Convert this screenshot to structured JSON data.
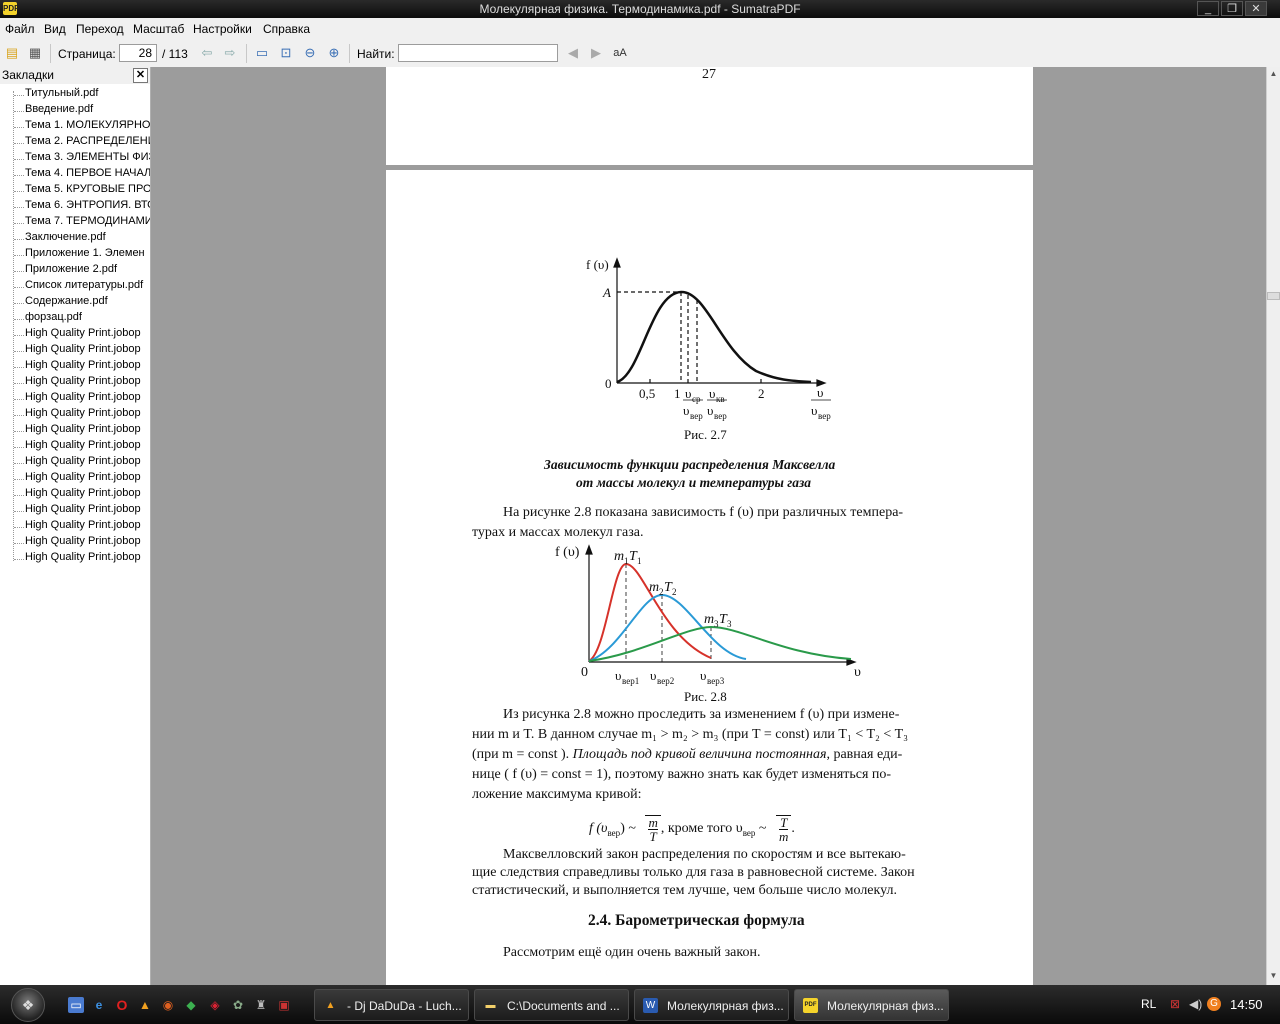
{
  "window": {
    "title": "Молекулярная физика. Термодинамика.pdf - SumatraPDF",
    "app_icon": "sumatra-icon"
  },
  "menu": [
    "Файл",
    "Вид",
    "Переход",
    "Масштаб",
    "Настройки",
    "Справка"
  ],
  "toolbar": {
    "page_label": "Страница:",
    "page_value": "28",
    "page_total": "/ 113",
    "find_label": "Найти:",
    "find_value": "",
    "font_icon_label": "aA"
  },
  "sidebar": {
    "title": "Закладки",
    "items": [
      "Титульный.pdf",
      "Введение.pdf",
      "Тема 1. МОЛЕКУЛЯРНО-",
      "Тема 2. РАСПРЕДЕЛЕНИ",
      "Тема 3. ЭЛЕМЕНТЫ ФИЗИ",
      "Тема 4. ПЕРВОЕ НАЧАЛО",
      "Тема 5.  КРУГОВЫЕ ПРО",
      "Тема 6. ЭНТРОПИЯ. ВТО",
      "Тема 7. ТЕРМОДИНАМИ",
      "Заключение.pdf",
      "Приложение 1. Элемен",
      "Приложение 2.pdf",
      "Список литературы.pdf",
      "Содержание.pdf",
      "форзац.pdf",
      "High Quality Print.jobop",
      "High Quality Print.jobop",
      "High Quality Print.jobop",
      "High Quality Print.jobop",
      "High Quality Print.jobop",
      "High Quality Print.jobop",
      "High Quality Print.jobop",
      "High Quality Print.jobop",
      "High Quality Print.jobop",
      "High Quality Print.jobop",
      "High Quality Print.jobop",
      "High Quality Print.jobop",
      "High Quality Print.jobop",
      "High Quality Print.jobop",
      "High Quality Print.jobop"
    ]
  },
  "document": {
    "prev_page_number": "27",
    "fig27": {
      "ylabel": "f (υ)",
      "a_label": "A",
      "origin": "0",
      "tick_05": "0,5",
      "tick_1": "1",
      "tick_2": "2",
      "v_sr": "υ",
      "v_sr_sub": "ср",
      "v_kv": "υ",
      "v_kv_sub": "кв",
      "v_ver": "υ",
      "v_ver_sub": "вер",
      "x_num": "υ",
      "caption": "Рис. 2.7"
    },
    "fig27_title_line1": "Зависимость функции распределения Максвелла",
    "fig27_title_line2": "от массы молекул и температуры газа",
    "para1_line1": "На рисунке 2.8 показана зависимость  f (υ)  при различных темпера-",
    "para1_line2": "турах и массах молекул газа.",
    "fig28": {
      "ylabel": "f (υ)",
      "origin": "0",
      "xlabel": "υ",
      "curve1_label": "m",
      "curve1_sub": "1",
      "curve1_t": "T",
      "curve2_label": "m",
      "curve2_sub": "2",
      "curve2_t": "T",
      "curve3_label": "m",
      "curve3_sub": "3",
      "curve3_t": "T",
      "tick1": "υ",
      "tick1_sub": "вер1",
      "tick2": "υ",
      "tick2_sub": "вер2",
      "tick3": "υ",
      "tick3_sub": "вер3",
      "caption": "Рис. 2.8",
      "colors": {
        "curve1": "#d6322a",
        "curve2": "#2a9ad6",
        "curve3": "#2a9a4a"
      }
    },
    "para2_line1": "Из рисунка 2.8 можно проследить за изменением  f (υ)  при измене-",
    "para2_line2": "нии m и T. В данном случае  m₁ > m₂ > m₃  (при  T = const) или  T₁ < T₂ < T₃",
    "para2_line3_a": "(при  m = const ). ",
    "para2_line3_b": "Площадь под кривой величина постоянная",
    "para2_line3_c": ", равная еди-",
    "para2_line4": "нице  ( f (υ) = const = 1),  поэтому важно знать как будет изменяться по-",
    "para2_line5": "ложение максимума кривой:",
    "formula_left": "f (υ",
    "formula_left_sub": "вер",
    "formula_left_end": ") ~",
    "formula_m": "m",
    "formula_T": "T",
    "formula_mid": ",  кроме того  υ",
    "formula_mid_sub": "вер",
    "formula_mid_end": " ~",
    "formula_T2": "T",
    "formula_m2": "m",
    "formula_dot": ".",
    "para3_line1": "Максвелловский закон распределения по скоростям и все вытекаю-",
    "para3_line2": "щие следствия справедливы только для газа в равновесной системе. Закон",
    "para3_line3": "статистический, и выполняется тем лучше, чем больше число молекул.",
    "section_heading": "2.4. Барометрическая формула",
    "para4": "Рассмотрим ещё один очень важный закон."
  },
  "taskbar": {
    "tasks": [
      {
        "label": "- Dj DaDuDa - Luch...",
        "icon": "aimp-icon"
      },
      {
        "label": "C:\\Documents and ...",
        "icon": "folder-icon"
      },
      {
        "label": "Молекулярная физ...",
        "icon": "word-icon"
      },
      {
        "label": "Молекулярная физ...",
        "icon": "sumatra-icon"
      }
    ],
    "language": "RL",
    "clock": "14:50"
  }
}
